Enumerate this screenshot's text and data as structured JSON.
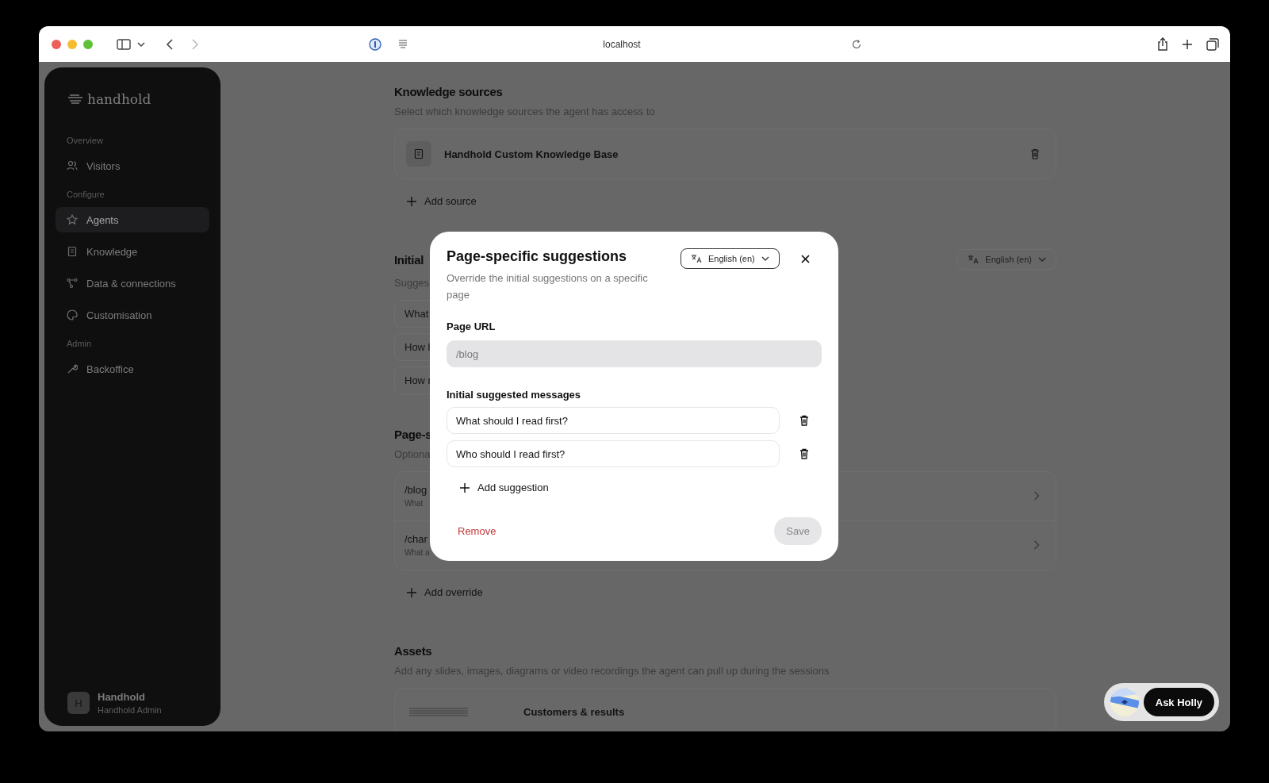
{
  "browser": {
    "address": "localhost"
  },
  "sidebar": {
    "logo": "handhold",
    "sections": [
      {
        "heading": "Overview",
        "items": [
          {
            "label": "Visitors",
            "selected": false
          }
        ]
      },
      {
        "heading": "Configure",
        "items": [
          {
            "label": "Agents",
            "selected": true
          },
          {
            "label": "Knowledge",
            "selected": false
          },
          {
            "label": "Data & connections",
            "selected": false
          },
          {
            "label": "Customisation",
            "selected": false
          }
        ]
      },
      {
        "heading": "Admin",
        "items": [
          {
            "label": "Backoffice",
            "selected": false
          }
        ]
      }
    ],
    "user": {
      "initial": "H",
      "name": "Handhold",
      "role": "Handhold Admin"
    }
  },
  "knowledge_sources": {
    "title": "Knowledge sources",
    "subtitle": "Select which knowledge sources the agent has access to",
    "sources": [
      {
        "name": "Handhold Custom Knowledge Base"
      }
    ],
    "add_label": "Add source"
  },
  "initial_suggestions": {
    "title": "Initial",
    "subtitle": "Sugges",
    "language": "English (en)",
    "rows": [
      "What",
      "How l",
      "How r"
    ]
  },
  "page_specific": {
    "title": "Page-s",
    "subtitle": "Optiona",
    "overrides": [
      {
        "path": "/blog",
        "preview": "What"
      },
      {
        "path": "/char",
        "preview": "What a"
      }
    ],
    "add_label": "Add override"
  },
  "assets": {
    "title": "Assets",
    "subtitle": "Add any slides, images, diagrams or video recordings the agent can pull up during the sessions",
    "items": [
      {
        "name": "Customers & results"
      }
    ]
  },
  "modal": {
    "title": "Page-specific suggestions",
    "subtitle": "Override the initial suggestions on a specific page",
    "language": "English (en)",
    "url_label": "Page URL",
    "url": {
      "value": "/blog",
      "disabled": true
    },
    "messages_label": "Initial suggested messages",
    "messages": [
      "What should I read first?",
      "Who should I read first?"
    ],
    "add_label": "Add suggestion",
    "remove_label": "Remove",
    "save": {
      "label": "Save",
      "disabled": true
    }
  },
  "chat": {
    "label": "Ask Holly"
  }
}
